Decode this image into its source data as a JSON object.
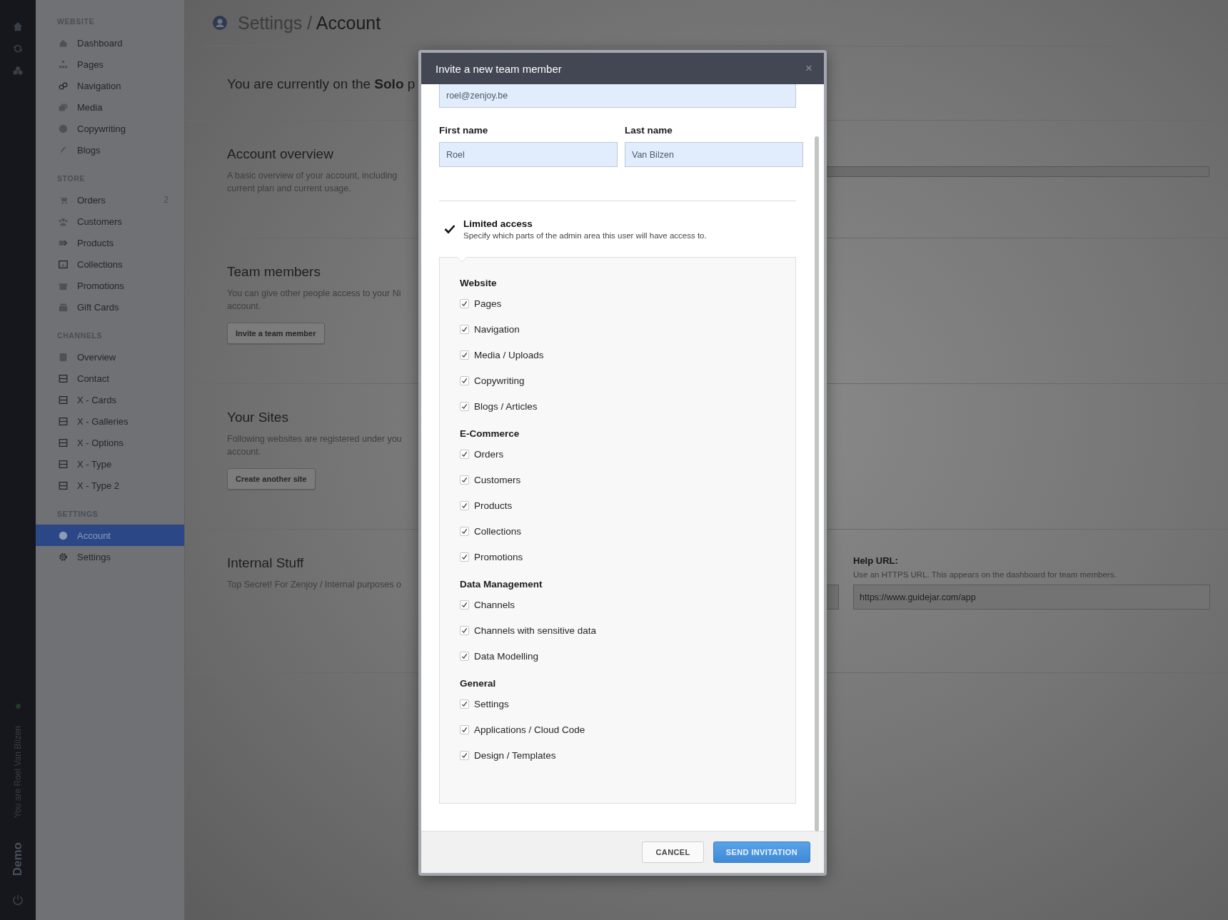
{
  "rail": {
    "user_label": "You are Roel Van Bilzen",
    "workspace": "Demo"
  },
  "sidebar": {
    "sections": [
      {
        "title": "WEBSITE",
        "items": [
          {
            "label": "Dashboard",
            "selected": false
          },
          {
            "label": "Pages",
            "selected": false
          },
          {
            "label": "Navigation",
            "selected": false
          },
          {
            "label": "Media",
            "selected": false
          },
          {
            "label": "Copywriting",
            "selected": false
          },
          {
            "label": "Blogs",
            "selected": false
          }
        ]
      },
      {
        "title": "STORE",
        "items": [
          {
            "label": "Orders",
            "count": "2",
            "selected": false
          },
          {
            "label": "Customers",
            "selected": false
          },
          {
            "label": "Products",
            "selected": false
          },
          {
            "label": "Collections",
            "selected": false
          },
          {
            "label": "Promotions",
            "selected": false
          },
          {
            "label": "Gift Cards",
            "selected": false
          }
        ]
      },
      {
        "title": "CHANNELS",
        "items": [
          {
            "label": "Overview",
            "selected": false
          },
          {
            "label": "Contact",
            "selected": false
          },
          {
            "label": "X - Cards",
            "selected": false
          },
          {
            "label": "X - Galleries",
            "selected": false
          },
          {
            "label": "X - Options",
            "selected": false
          },
          {
            "label": "X - Type",
            "selected": false
          },
          {
            "label": "X - Type 2",
            "selected": false
          }
        ]
      },
      {
        "title": "SETTINGS",
        "items": [
          {
            "label": "Account",
            "selected": true
          },
          {
            "label": "Settings",
            "selected": false
          }
        ]
      }
    ]
  },
  "page": {
    "breadcrumb": "Settings",
    "separator": "/",
    "title": "Account",
    "plan_text": "You are currently on the **Solo** p",
    "sections": [
      {
        "title": "Account overview",
        "description": "A basic overview of your account, including current plan and current usage."
      },
      {
        "title": "Team members",
        "description": "You can give other people access to your Ni account.",
        "button": "Invite a team member"
      },
      {
        "title": "Your Sites",
        "description": "Following websites are registered under you account.",
        "button": "Create another site"
      },
      {
        "title": "Internal Stuff",
        "description": "Top Secret! For Zenjoy / Internal purposes o"
      }
    ],
    "help_url": {
      "label": "Help URL:",
      "hint": "Use an HTTPS URL. This appears on the dashboard for team members.",
      "value": "https://www.guidejar.com/app"
    }
  },
  "modal": {
    "title": "Invite a new team member",
    "close": "×",
    "email": "roel@zenjoy.be",
    "first_name": {
      "label": "First name",
      "value": "Roel"
    },
    "last_name": {
      "label": "Last name",
      "value": "Van Bilzen"
    },
    "limited_access": {
      "label": "Limited access",
      "description": "Specify which parts of the admin area this user will have access to.",
      "checked": true
    },
    "permission_groups": [
      {
        "title": "Website",
        "items": [
          {
            "label": "Pages",
            "checked": true
          },
          {
            "label": "Navigation",
            "checked": true
          },
          {
            "label": "Media / Uploads",
            "checked": true
          },
          {
            "label": "Copywriting",
            "checked": true
          },
          {
            "label": "Blogs / Articles",
            "checked": true
          }
        ]
      },
      {
        "title": "E-Commerce",
        "items": [
          {
            "label": "Orders",
            "checked": true
          },
          {
            "label": "Customers",
            "checked": true
          },
          {
            "label": "Products",
            "checked": true
          },
          {
            "label": "Collections",
            "checked": true
          },
          {
            "label": "Promotions",
            "checked": true
          }
        ]
      },
      {
        "title": "Data Management",
        "items": [
          {
            "label": "Channels",
            "checked": true
          },
          {
            "label": "Channels with sensitive data",
            "checked": true
          },
          {
            "label": "Data Modelling",
            "checked": true
          }
        ]
      },
      {
        "title": "General",
        "items": [
          {
            "label": "Settings",
            "checked": true
          },
          {
            "label": "Applications / Cloud Code",
            "checked": true
          },
          {
            "label": "Design / Templates",
            "checked": true
          }
        ]
      }
    ],
    "buttons": {
      "cancel": "CANCEL",
      "submit": "SEND INVITATION"
    }
  }
}
